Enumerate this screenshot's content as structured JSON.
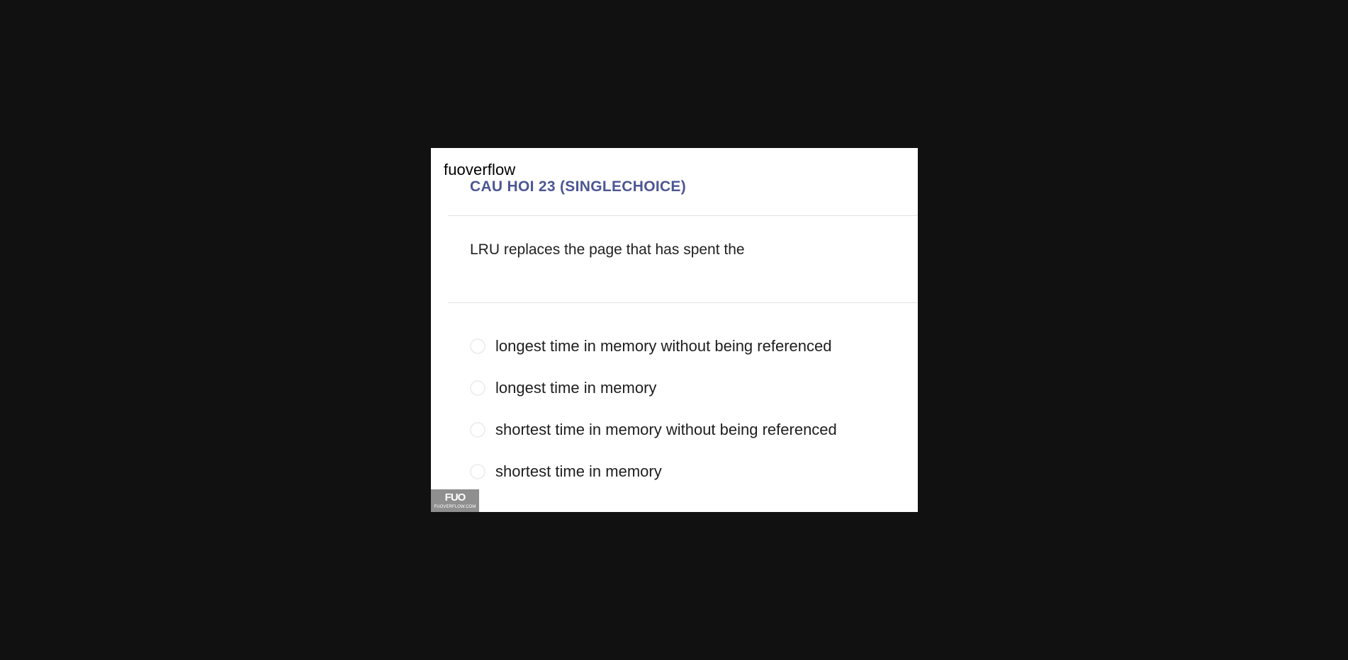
{
  "site": {
    "name": "fuoverflow"
  },
  "question": {
    "title": "CAU HOI 23 (SINGLECHOICE)",
    "text": "LRU replaces the page that has spent the",
    "options": [
      {
        "label": "longest time in memory without being referenced"
      },
      {
        "label": "longest time in memory"
      },
      {
        "label": "shortest time in memory without being referenced"
      },
      {
        "label": "shortest time in memory"
      }
    ]
  },
  "logo": {
    "mark": "FUO",
    "sub": "FUOVERFLOW.COM"
  },
  "colors": {
    "page_background": "#111111",
    "panel_background": "#ffffff",
    "title_accent": "#4c5695",
    "logo_background": "#8f8f8f"
  }
}
